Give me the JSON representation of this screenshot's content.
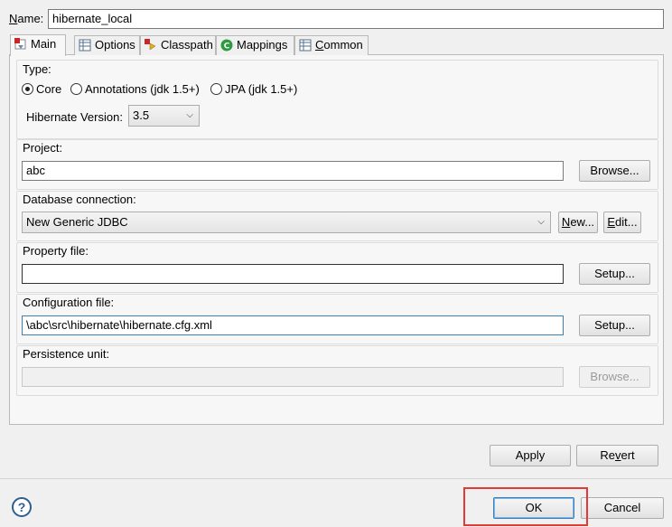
{
  "name_field": {
    "label": "Name:",
    "value": "hibernate_local"
  },
  "tabs": [
    {
      "label": "Main",
      "icon": "hibernate-main-icon",
      "active": true
    },
    {
      "label": "Options",
      "icon": "table-icon"
    },
    {
      "label": "Classpath",
      "icon": "classpath-icon"
    },
    {
      "label": "Mappings",
      "icon": "mappings-c-icon"
    },
    {
      "label": "Common",
      "icon": "table-icon"
    }
  ],
  "type_group": {
    "label": "Type:",
    "options": [
      "Core",
      "Annotations (jdk 1.5+)",
      "JPA (jdk 1.5+)"
    ],
    "selected": "Core",
    "version_label": "Hibernate Version:",
    "version_value": "3.5"
  },
  "project": {
    "label": "Project:",
    "value": "abc",
    "browse": "Browse..."
  },
  "db_connection": {
    "label": "Database connection:",
    "value": "New Generic JDBC",
    "new": "New...",
    "edit": "Edit..."
  },
  "property_file": {
    "label": "Property file:",
    "value": "",
    "setup": "Setup..."
  },
  "config_file": {
    "label": "Configuration file:",
    "value": "\\abc\\src\\hibernate\\hibernate.cfg.xml",
    "setup": "Setup..."
  },
  "persistence_unit": {
    "label": "Persistence unit:",
    "value": "",
    "browse": "Browse..."
  },
  "apply": "Apply",
  "revert": "Revert",
  "ok": "OK",
  "cancel": "Cancel",
  "help": "?",
  "colors": {
    "highlight_box": "#e53935",
    "focus_border": "#3c7fb1"
  }
}
